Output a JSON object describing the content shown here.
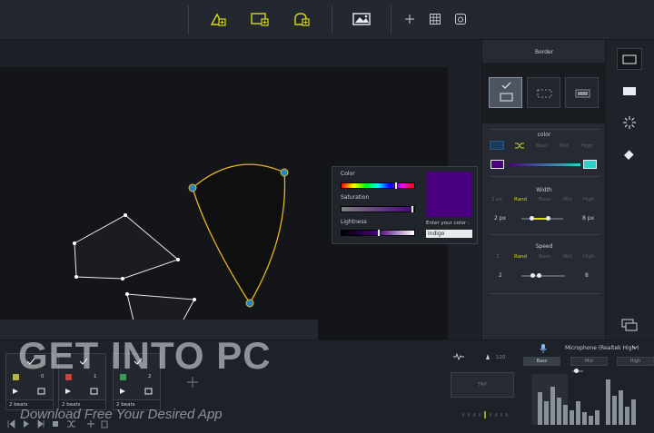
{
  "toolbar": {
    "buttons": [
      {
        "name": "add-shape-icon"
      },
      {
        "name": "add-screen-icon"
      },
      {
        "name": "add-mask-icon"
      },
      {
        "name": "image-icon"
      },
      {
        "name": "crosshair-icon"
      },
      {
        "name": "grid-icon"
      },
      {
        "name": "record-icon"
      }
    ],
    "accent": "#d6d91c"
  },
  "canvas": {
    "outline_color": "#e6b422",
    "handle_color": "#1e88c8"
  },
  "color_popup": {
    "color_label": "Color",
    "saturation_label": "Saturation",
    "lightness_label": "Lightness",
    "enter_label": "Enter your color :",
    "color_value": "indigo",
    "swatch_color": "#4b0082"
  },
  "border_panel": {
    "title": "Border",
    "color": {
      "title": "color",
      "options": [
        "Bass",
        "Mid",
        "High"
      ]
    },
    "width": {
      "title": "Width",
      "options": [
        "2 px",
        "Rand",
        "Bass",
        "Mid",
        "High"
      ],
      "selected": "Rand",
      "min": "2 px",
      "max": "8 px"
    },
    "speed": {
      "title": "Speed",
      "options": [
        "2",
        "Rand",
        "Bass",
        "Mid",
        "High"
      ],
      "selected": "Rand",
      "min": "2",
      "max": "8"
    }
  },
  "rail": {
    "buttons": [
      {
        "name": "border-icon"
      },
      {
        "name": "fill-icon"
      },
      {
        "name": "sparkle-icon"
      },
      {
        "name": "eraser-icon"
      },
      {
        "name": "screens-icon"
      }
    ]
  },
  "tracks": [
    {
      "number": "0",
      "color": "#b8b44a",
      "beats": "2 beats"
    },
    {
      "number": "1",
      "color": "#c0483e",
      "beats": "2 beats"
    },
    {
      "number": "2",
      "color": "#3e9a5a",
      "beats": "2 beats"
    }
  ],
  "audio": {
    "input": "Microphone (Realtek High I",
    "bpm": "120",
    "tap_label": "TAP",
    "tabs": [
      "Bass",
      "Mid",
      "High"
    ]
  },
  "watermark": {
    "title": "GET INTO PC",
    "subtitle": "Download Free Your Desired App"
  }
}
